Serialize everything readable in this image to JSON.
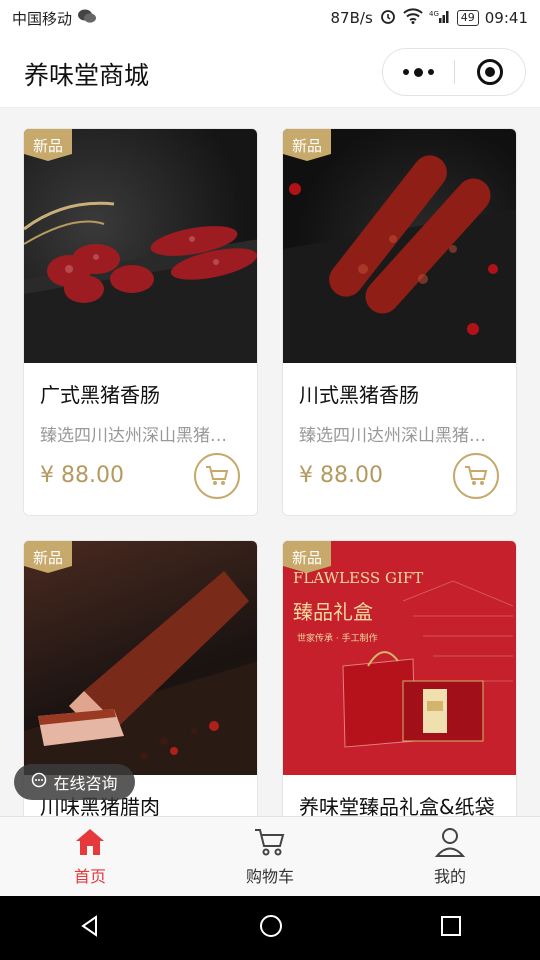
{
  "status_bar": {
    "carrier": "中国移动",
    "speed": "87B/s",
    "network": "4G",
    "battery": "49",
    "time": "09:41"
  },
  "header": {
    "title": "养味堂商城"
  },
  "products": [
    {
      "badge": "新品",
      "name": "广式黑猪香肠",
      "desc": "臻选四川达州深山黑猪…",
      "price": "¥ 88.00"
    },
    {
      "badge": "新品",
      "name": "川式黑猪香肠",
      "desc": "臻选四川达州深山黑猪…",
      "price": "¥ 88.00"
    },
    {
      "badge": "新品",
      "name": "川味黑猪腊肉"
    },
    {
      "badge": "新品",
      "name": "养味堂臻品礼盒&纸袋",
      "img_title": "FLAWLESS GIFT",
      "img_subtitle": "臻品礼盒",
      "img_tagline": "世家传承 · 手工制作"
    }
  ],
  "chat": {
    "label": "在线咨询"
  },
  "tabbar": {
    "tabs": [
      {
        "label": "首页",
        "active": true
      },
      {
        "label": "购物车"
      },
      {
        "label": "我的"
      }
    ]
  },
  "colors": {
    "accent": "#e5393c",
    "gold": "#c7a96b",
    "price": "#b59a60"
  }
}
